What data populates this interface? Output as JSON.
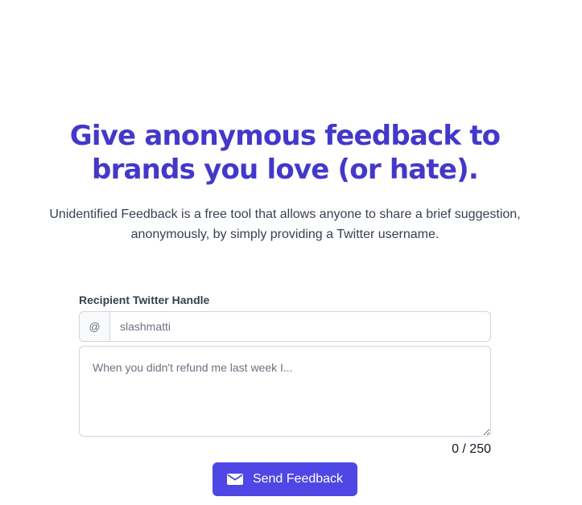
{
  "hero": {
    "headline_line1": "Give anonymous feedback to",
    "headline_line2": "brands you love (or hate).",
    "subtitle": "Unidentified Feedback is a free tool that allows anyone to share a brief suggestion, anonymously, by simply providing a Twitter username."
  },
  "form": {
    "handle_label": "Recipient Twitter Handle",
    "handle_prefix": "@",
    "handle_placeholder": "slashmatti",
    "message_placeholder": "When you didn't refund me last week I...",
    "char_count": "0 / 250",
    "submit_label": "Send Feedback",
    "submit_icon": "envelope-icon"
  },
  "colors": {
    "headline": "#4338ca",
    "button": "#4f46e5"
  }
}
